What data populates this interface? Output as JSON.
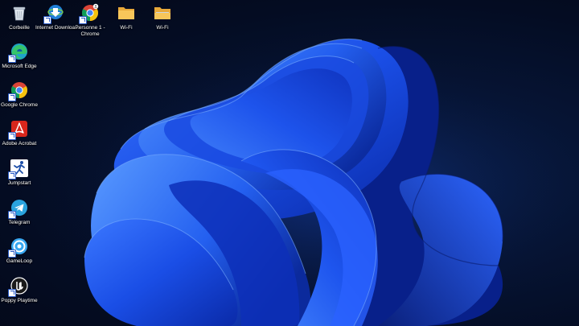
{
  "desktop": {
    "icons": [
      {
        "label": "Corbeille",
        "icon": "recycle-bin-icon"
      },
      {
        "label": "Internet Downloa...",
        "icon": "internet-download-manager-icon"
      },
      {
        "label": "Personne 1 - Chrome",
        "icon": "chrome-profile-icon"
      },
      {
        "label": "Wi-Fi",
        "icon": "folder-icon"
      },
      {
        "label": "Wi-Fi",
        "icon": "folder-icon"
      },
      {
        "label": "Microsoft Edge",
        "icon": "edge-icon"
      },
      {
        "label": "Google Chrome",
        "icon": "chrome-icon"
      },
      {
        "label": "Adobe Acrobat",
        "icon": "acrobat-icon"
      },
      {
        "label": "Jumpstart",
        "icon": "jumpstart-icon"
      },
      {
        "label": "Telegram",
        "icon": "telegram-icon"
      },
      {
        "label": "GameLoop",
        "icon": "gameloop-icon"
      },
      {
        "label": "Poppy Playtime",
        "icon": "unreal-engine-icon"
      }
    ]
  },
  "colors": {
    "background": "#040c22",
    "wallpaper_accent": "#2a5cff",
    "label_text": "#ffffff"
  }
}
